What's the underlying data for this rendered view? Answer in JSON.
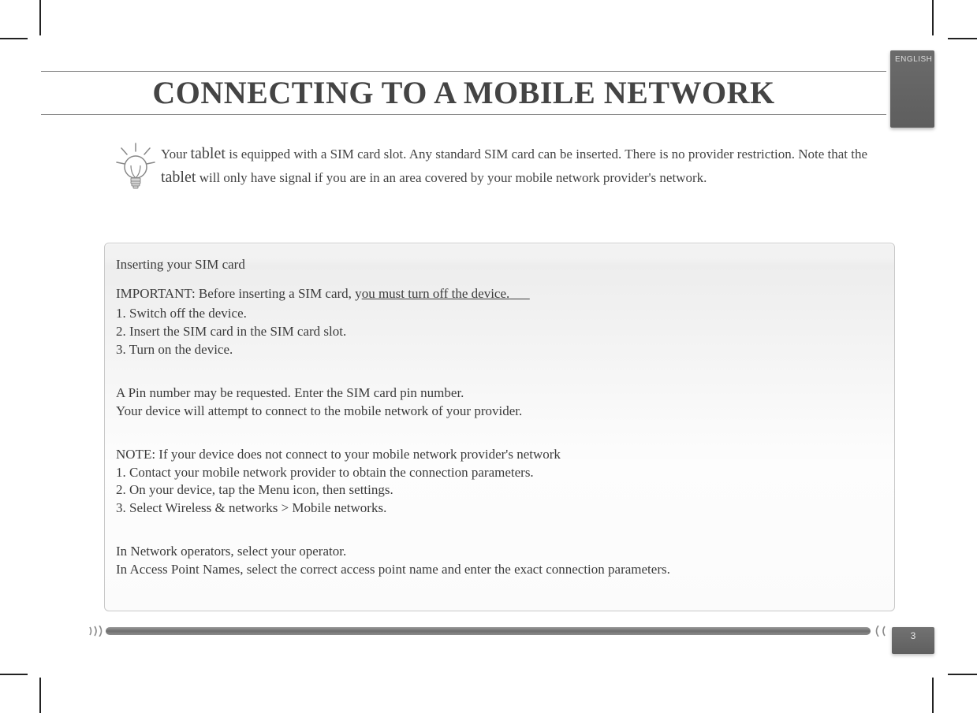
{
  "title": "CONNECTING TO A MOBILE NETWORK",
  "language_tab": "ENGLISH",
  "page_number": "3",
  "intro": {
    "p1a": "Your ",
    "tablet1": "tablet",
    "p1b": " is equipped with a SIM card slot. Any standard SIM card can be inserted. There is no provider restriction. Note that the ",
    "tablet2": "tablet",
    "p1c": " will only have signal if you are in an area covered by your mobile network provider's network."
  },
  "panel": {
    "section_title": "Inserting your SIM card",
    "important_prefix": "IMPORTANT: Before inserting a SIM card, y",
    "important_underlined": "ou must turn off the device.",
    "steps_a": {
      "s1": "1. Switch off the device.",
      "s2": "2. Insert the SIM card in the SIM card slot.",
      "s3": "3. Turn on the device."
    },
    "pin_line1": "A Pin number may be requested. Enter the SIM card pin number.",
    "pin_line2": "Your device will attempt to connect to the mobile network of your provider.",
    "note_title": "NOTE: If your device does not connect to your mobile network provider's network",
    "steps_b": {
      "s1": "1. Contact your mobile network provider to obtain the connection parameters.",
      "s2": "2. On your device, tap the Menu icon, then settings.",
      "s3": "3. Select Wireless & networks > Mobile networks."
    },
    "final1": "In Network operators, select your operator.",
    "final2": "In Access Point Names, select the correct access point name and enter the exact connection parameters."
  }
}
